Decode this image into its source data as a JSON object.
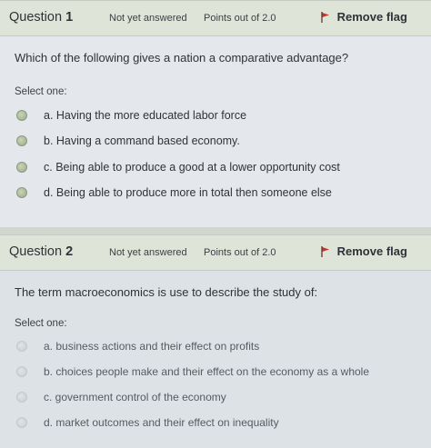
{
  "questions": [
    {
      "title_prefix": "Question",
      "number": "1",
      "state": "Not yet answered",
      "points": "Points out of 2.0",
      "flag_label": "Remove flag",
      "text": "Which of the following gives a nation a comparative advantage?",
      "select_label": "Select one:",
      "options": [
        "a. Having the more educated labor force",
        "b. Having a command based economy.",
        "c. Being able to produce a good at a lower opportunity cost",
        "d. Being able to produce more in total then someone else"
      ]
    },
    {
      "title_prefix": "Question",
      "number": "2",
      "state": "Not yet answered",
      "points": "Points out of 2.0",
      "flag_label": "Remove flag",
      "text": "The term macroeconomics is use to describe the study of:",
      "select_label": "Select one:",
      "options": [
        "a. business actions and their effect on profits",
        "b. choices people make and their effect on the economy as a whole",
        "c. government control of the economy",
        "d. market outcomes and their effect on inequality"
      ]
    }
  ],
  "colors": {
    "flag": "#c0392b",
    "header_bg": "#dfe4d9",
    "body_bg": "#e4e8ec"
  },
  "icons": {
    "flag": "flag-icon",
    "radio": "radio-button"
  }
}
